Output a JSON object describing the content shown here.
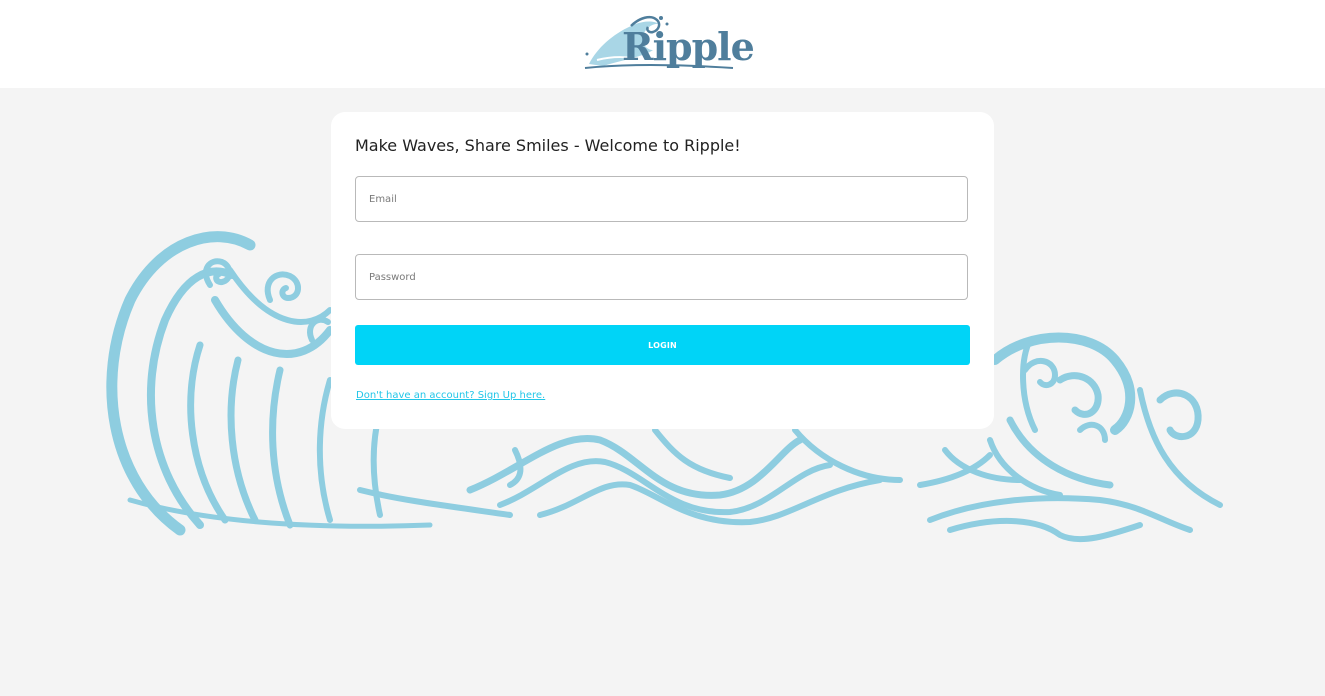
{
  "header": {
    "logo_text": "Ripple"
  },
  "login_card": {
    "title": "Make Waves, Share Smiles - Welcome to Ripple!",
    "email": {
      "placeholder": "Email",
      "value": ""
    },
    "password": {
      "placeholder": "Password",
      "value": ""
    },
    "login_label": "LOGIN",
    "signup_link": "Don't have an account? Sign Up here."
  },
  "colors": {
    "accent": "#00d4f7",
    "link": "#22c6e8",
    "wave": "#8ecde0",
    "logo": "#4f7e9c",
    "background": "#f4f4f4"
  },
  "icons": {
    "logo": "wave-logo-icon",
    "background": "decorative-waves"
  }
}
